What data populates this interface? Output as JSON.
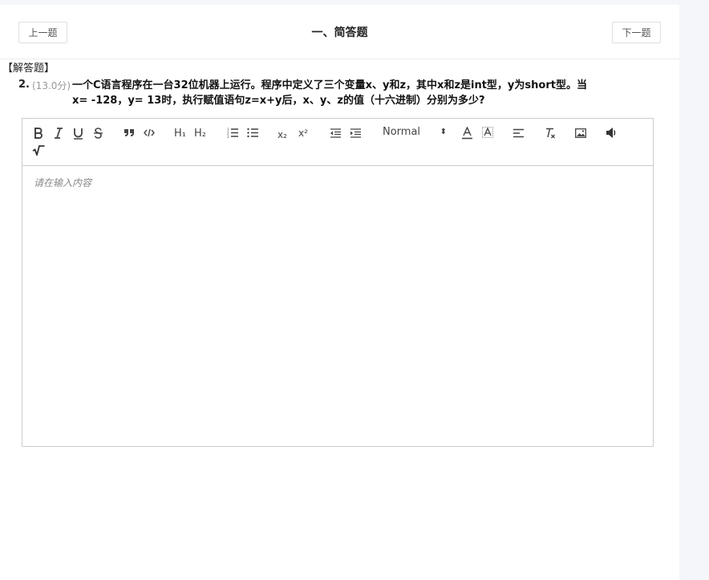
{
  "header": {
    "prev_label": "上一题",
    "title": "一、简答题",
    "next_label": "下一题"
  },
  "question": {
    "type_label": "【解答题】",
    "number": "2.",
    "score": "(13.0分)",
    "text": "一个C语言程序在一台32位机器上运行。程序中定义了三个变量x、y和z，其中x和z是int型，y为short型。当x= -128，y= 13时，执行赋值语句z=x+y后，x、y、z的值（十六进制）分别为多少?"
  },
  "editor": {
    "toolbar": {
      "h1": "H₁",
      "h2": "H₂",
      "sub": "x₂",
      "sup": "x²",
      "heading_select": "Normal",
      "icons": [
        "bold-icon",
        "italic-icon",
        "underline-icon",
        "strike-icon",
        "blockquote-icon",
        "code-icon",
        "h1-icon",
        "h2-icon",
        "ordered-list-icon",
        "bullet-list-icon",
        "subscript-icon",
        "superscript-icon",
        "outdent-icon",
        "indent-icon",
        "text-color-icon",
        "background-color-icon",
        "align-icon",
        "clear-format-icon",
        "image-icon",
        "audio-icon",
        "formula-icon"
      ]
    },
    "placeholder": "请在输入内容"
  }
}
